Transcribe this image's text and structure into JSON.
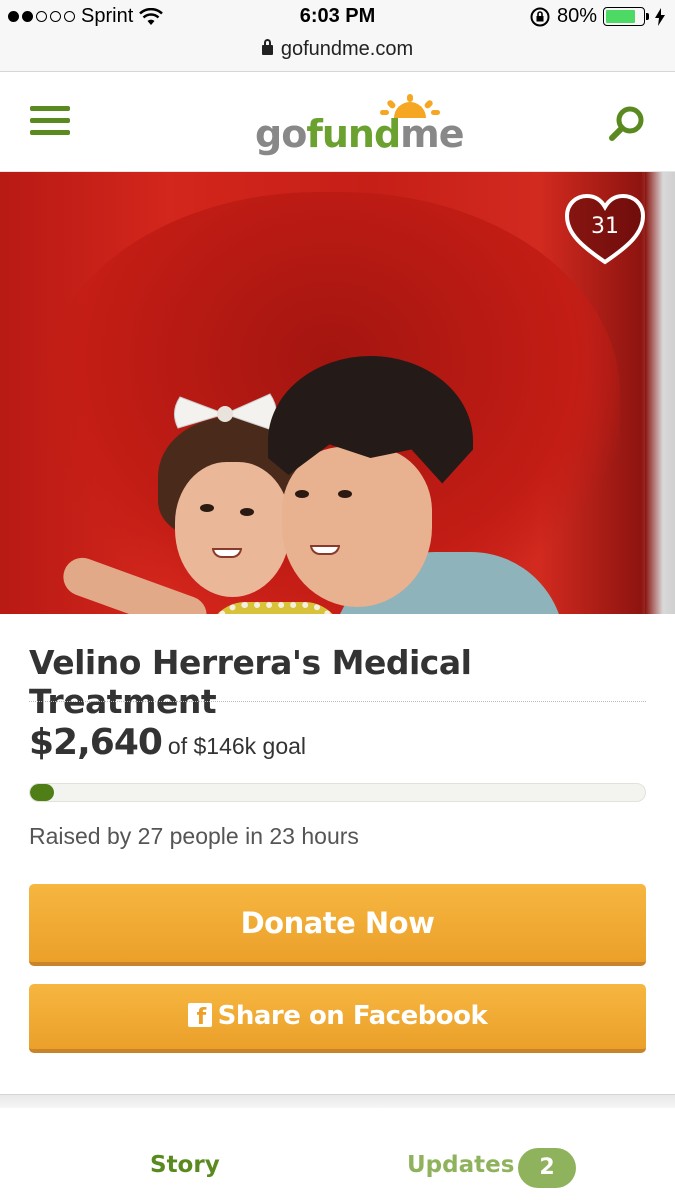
{
  "status_bar": {
    "carrier": "Sprint",
    "time": "6:03 PM",
    "battery_percent": "80%",
    "battery_level": 0.8,
    "signal_bars_filled": 2,
    "signal_bars_total": 5,
    "icons": [
      "wifi-icon",
      "orientation-lock-icon",
      "battery-icon",
      "charging-icon"
    ]
  },
  "browser": {
    "url": "gofundme.com",
    "icons": [
      "lock-icon"
    ]
  },
  "header": {
    "logo_parts": [
      "go",
      "fund",
      "me"
    ],
    "icons": [
      "hamburger-menu-icon",
      "search-icon"
    ],
    "colors": {
      "brand_green": "#5a8a1f",
      "logo_gray": "#888888"
    }
  },
  "hero": {
    "photo_alt": "",
    "heart_count": "31"
  },
  "campaign": {
    "title": "Velino Herrera's Medical Treatment",
    "raised_amount": "$2,640",
    "goal_text": "of $146k goal",
    "progress_fraction": 0.018,
    "raised_by": "Raised by 27 people in 23 hours"
  },
  "actions": {
    "donate_label": "Donate Now",
    "share_label": "Share on Facebook",
    "colors": {
      "button_orange": "#eba02a"
    }
  },
  "tabs": {
    "story_label": "Story",
    "updates_label": "Updates",
    "updates_count": "2"
  }
}
